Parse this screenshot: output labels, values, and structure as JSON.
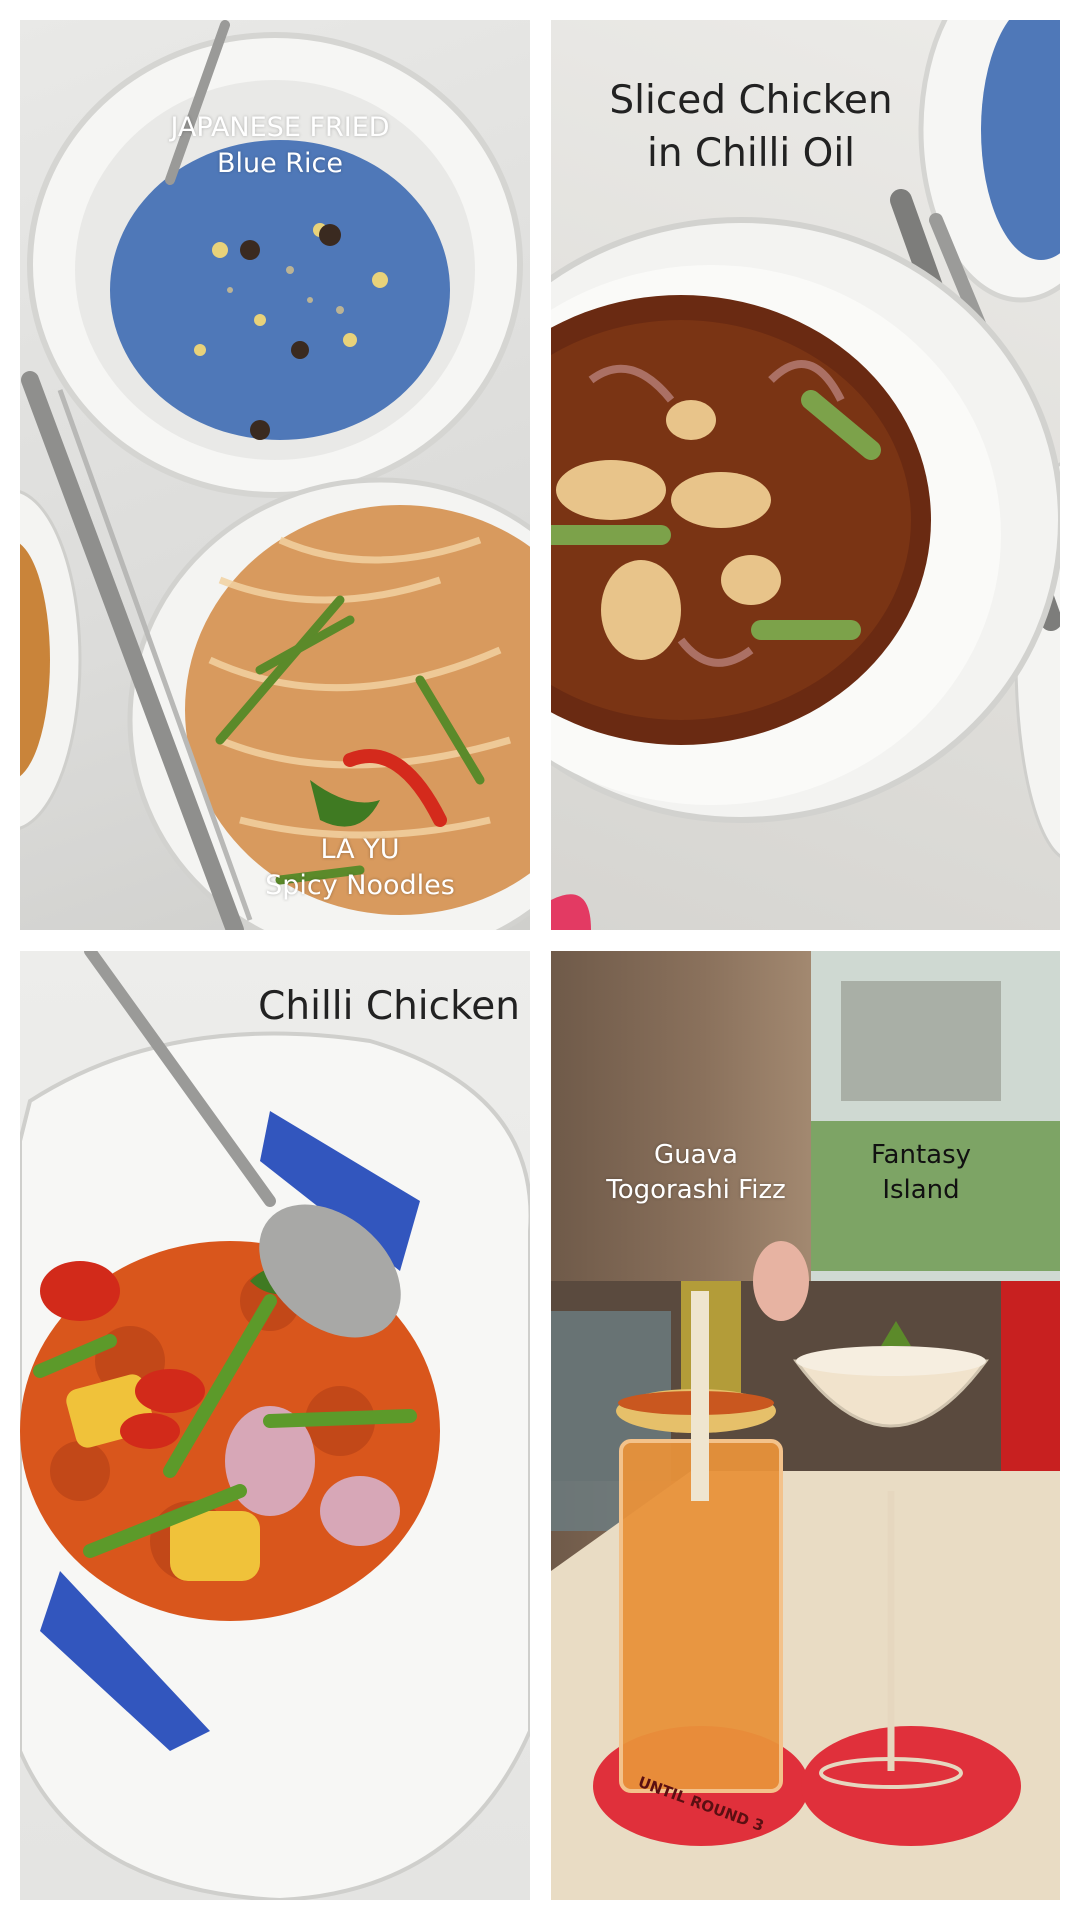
{
  "panels": [
    {
      "id": "blue-rice",
      "caption": "JAPANESE FRIED\nBlue Rice"
    },
    {
      "id": "spicy-noodles",
      "caption": "LA YU\nSpicy Noodles"
    },
    {
      "id": "sliced-chicken",
      "caption": "Sliced Chicken\nin Chilli Oil"
    },
    {
      "id": "chilli-chicken",
      "caption": "Chilli Chicken"
    },
    {
      "id": "guava-fizz",
      "caption": "Guava\nTogorashi Fizz"
    },
    {
      "id": "fantasy-island",
      "caption": "Fantasy\nIsland"
    }
  ],
  "coaster_text": "UNTIL ROUND 3",
  "colors": {
    "blue_rice": "#4f78b8",
    "chilli_oil": "#6a2a12",
    "sauce_orange": "#d9561c",
    "coaster_red": "#e0303b",
    "caption_dark": "#222222",
    "caption_light": "#ffffff"
  }
}
